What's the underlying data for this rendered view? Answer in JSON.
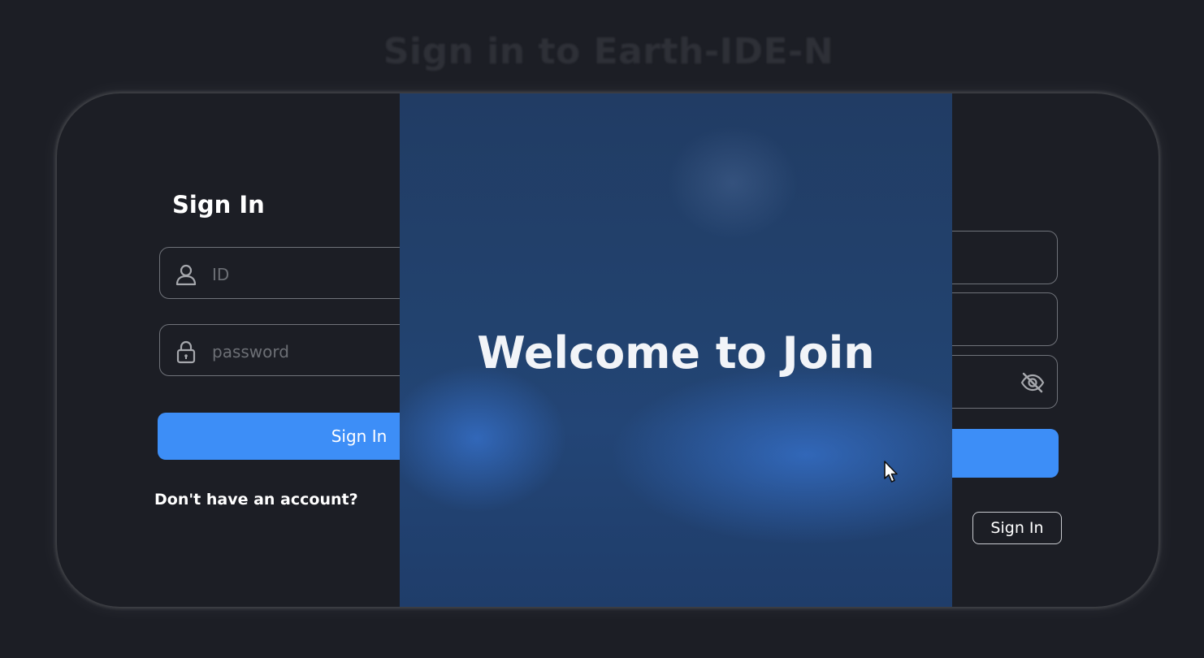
{
  "page": {
    "title": "Sign in to Earth-IDE-N"
  },
  "signin": {
    "heading": "Sign In",
    "id_placeholder": "ID",
    "password_placeholder": "password",
    "button_label": "Sign In",
    "no_account_link": "Don't have an account?"
  },
  "overlay": {
    "text": "Welcome to Join"
  },
  "signup": {
    "ghost_button_label": "Sign In"
  },
  "icons": {
    "id_field": "user-icon",
    "password_field": "lock-icon",
    "password_visibility": "eye-off-icon",
    "pointer": "cursor-icon"
  },
  "colors": {
    "background": "#1c1e25",
    "accent": "#3d8ef7",
    "overlay": "#22426e"
  }
}
